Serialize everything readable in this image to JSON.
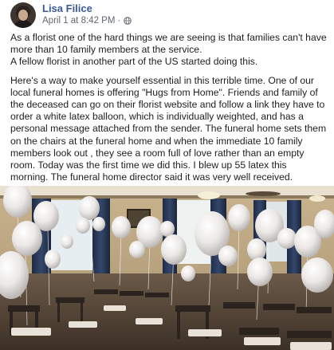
{
  "post": {
    "author": "Lisa Filice",
    "timestamp": "April 1 at 8:42 PM",
    "separator": "·",
    "audience_icon": "globe-icon",
    "paragraphs": [
      "As a florist one of the hard things we are seeing is that families can't have more than 10 family members at the service.",
      "A fellow florist in another part of the US started doing this.",
      "Here's a way to make yourself essential in this terrible time. One of our local funeral homes is offering \"Hugs from Home\". Friends and family of the deceased can go on their florist website and follow a link they have to order a white latex balloon, which is individually weighted, and has a personal message attached from the sender. The funeral home sets them on the chairs at the funeral home and when the immediate 10 family members look out , they see a room full of love rather than an empty room. Today was the first time we did this. I blew up 55 latex this morning. The funeral home director said it was very well received."
    ],
    "photo": {
      "subject": "funeral-room-with-white-balloons-on-chairs"
    }
  },
  "colors": {
    "name_link": "#385898",
    "meta_text": "#616770",
    "body_text": "#1c1e21"
  }
}
